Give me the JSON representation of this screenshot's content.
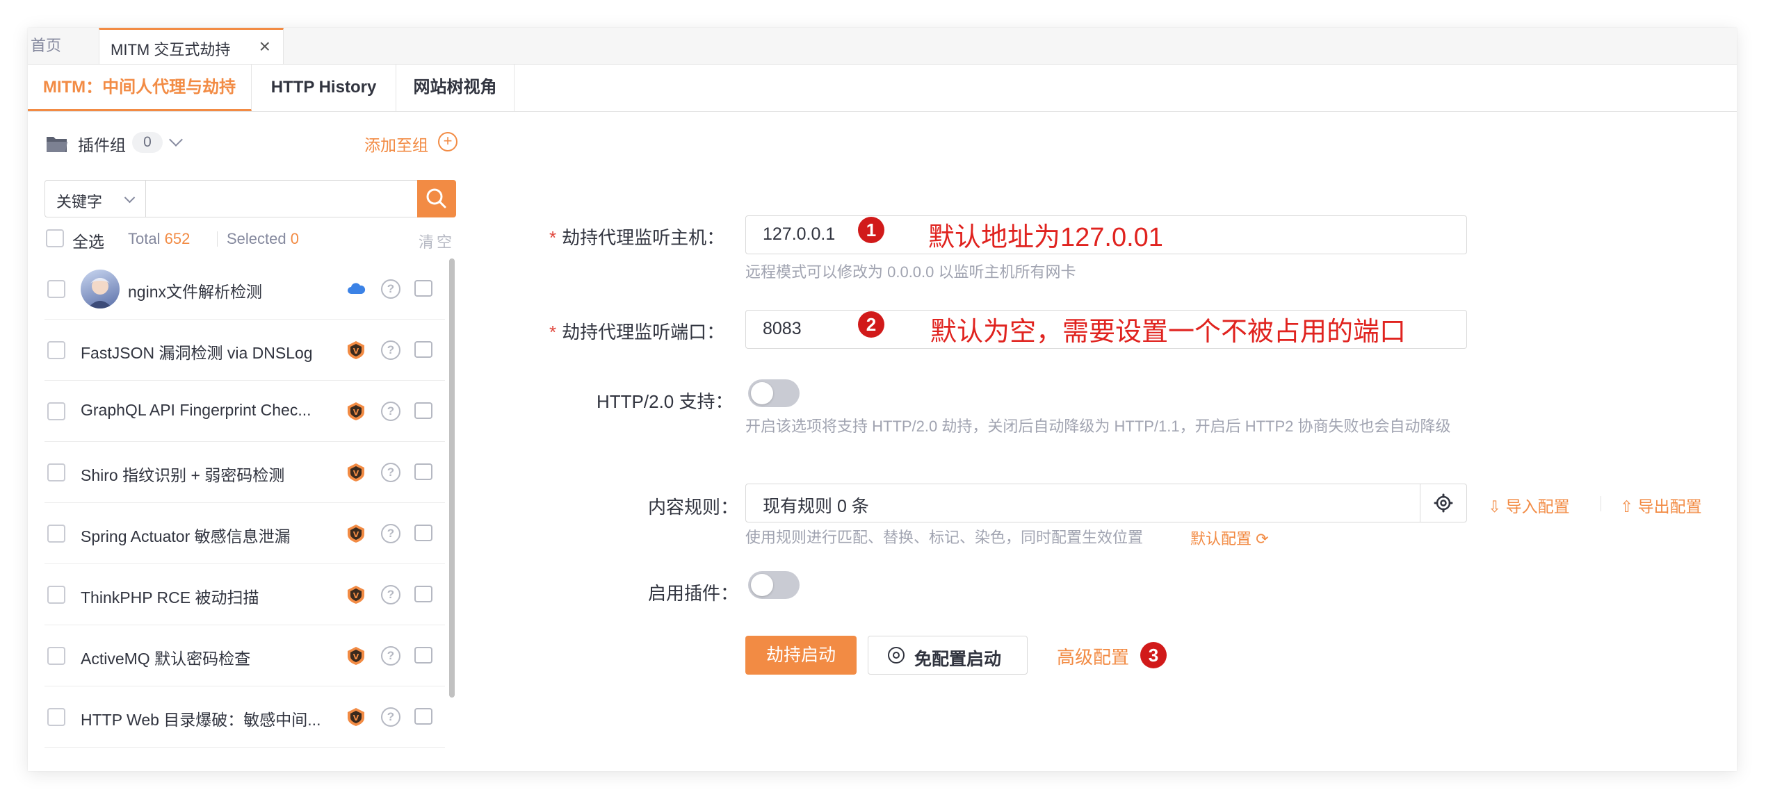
{
  "tabs": {
    "home": "首页",
    "mitm": "MITM 交互式劫持",
    "close": "×"
  },
  "subtabs": [
    "MITM：中间人代理与劫持",
    "HTTP History",
    "网站树视角"
  ],
  "left": {
    "group_label": "插件组",
    "group_count": "0",
    "add_to": "添加至组",
    "search_type": "关键字",
    "search_value": "",
    "select_all": "全选",
    "total_label": "Total",
    "total_value": "652",
    "selected_label": "Selected",
    "selected_value": "0",
    "clear": "清空",
    "plugins": [
      "nginx文件解析检测",
      "FastJSON 漏洞检测 via DNSLog",
      "GraphQL API Fingerprint Chec...",
      "Shiro 指纹识别 + 弱密码检测",
      "Spring Actuator 敏感信息泄漏",
      "ThinkPHP RCE 被动扫描",
      "ActiveMQ 默认密码检查",
      "HTTP Web 目录爆破：敏感中间..."
    ]
  },
  "form": {
    "host_label": "劫持代理监听主机：",
    "host_value": "127.0.0.1",
    "host_hint": "远程模式可以修改为 0.0.0.0 以监听主机所有网卡",
    "port_label": "劫持代理监听端口：",
    "port_value": "8083",
    "http2_label": "HTTP/2.0 支持：",
    "http2_hint": "开启该选项将支持 HTTP/2.0 劫持，关闭后自动降级为 HTTP/1.1，开启后 HTTP2 协商失败也会自动降级",
    "rules_label": "内容规则：",
    "rules_value": "现有规则 0 条",
    "rules_hint": "使用规则进行匹配、替换、标记、染色，同时配置生效位置",
    "default_config": "默认配置",
    "import": "导入配置",
    "export": "导出配置",
    "plugin_label": "启用插件：",
    "start": "劫持启动",
    "start_noconf": "免配置启动",
    "advanced": "高级配置"
  },
  "annotations": {
    "a1": "默认地址为127.0.01",
    "a2": "默认为空，需要设置一个不被占用的端口",
    "n1": "1",
    "n2": "2",
    "n3": "3"
  },
  "colors": {
    "accent": "#f28b44",
    "annotation": "#e0231f"
  }
}
